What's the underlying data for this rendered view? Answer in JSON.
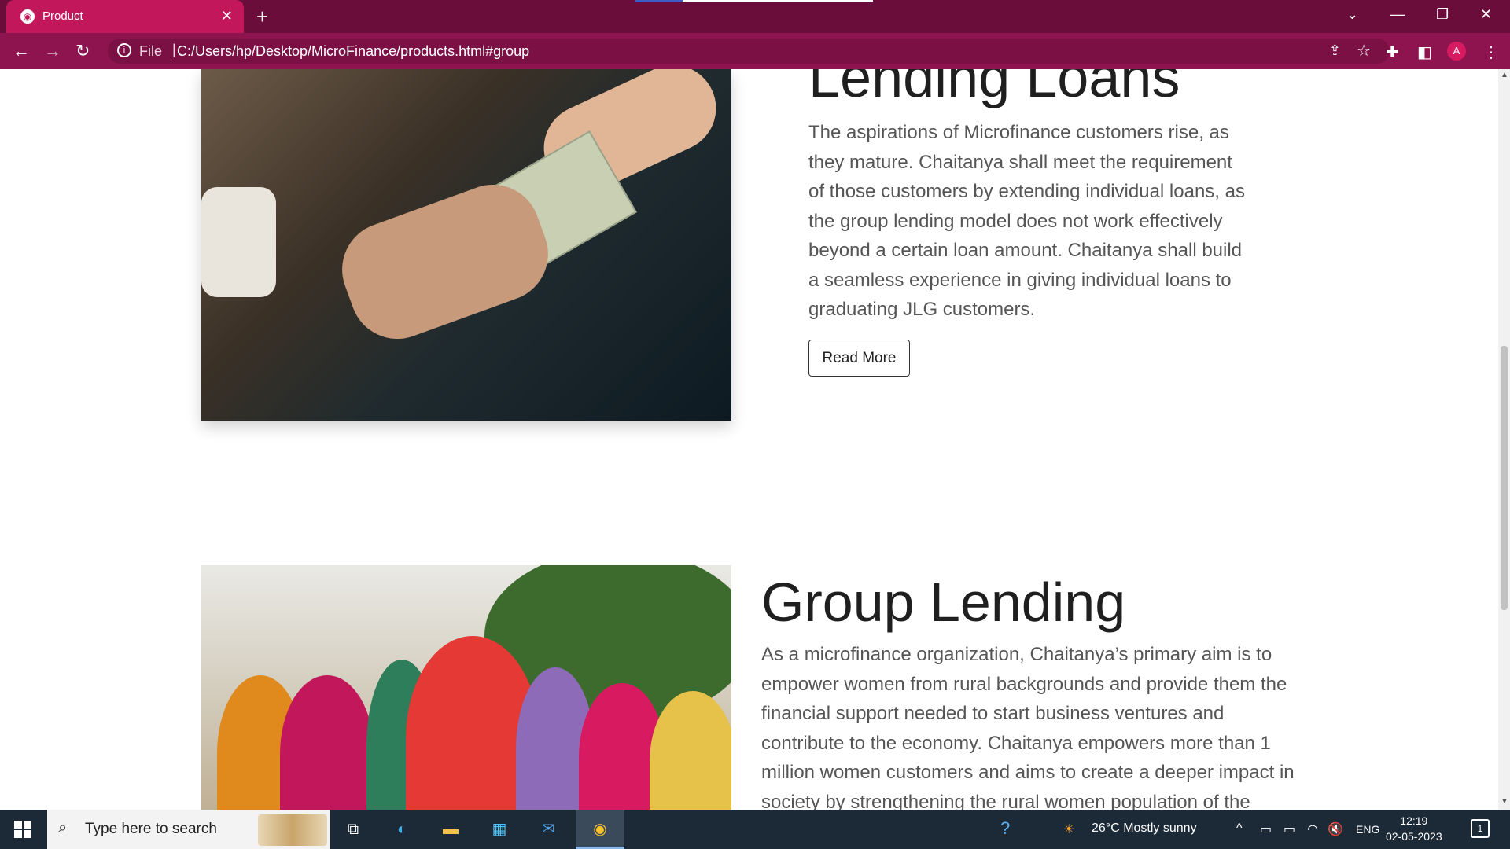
{
  "browser": {
    "tab_title": "Product",
    "tab_close": "✕",
    "new_tab": "+",
    "file_label": "File",
    "separator": "|",
    "url": "C:/Users/hp/Desktop/MicroFinance/products.html#group",
    "profile_initial": "A"
  },
  "sections": {
    "individual": {
      "heading": "Lending Loans",
      "body": "The aspirations of Microfinance customers rise, as they mature. Chaitanya shall meet the requirement of those customers by extending individual loans, as the group lending model does not work effectively beyond a certain loan amount. Chaitanya shall build a seamless experience in giving individual loans to graduating JLG customers.",
      "button": "Read More"
    },
    "group": {
      "heading": "Group Lending",
      "body": "As a microfinance organization, Chaitanya’s primary aim is to empower women from rural backgrounds and provide them the financial support needed to start business ventures and contribute to the economy. Chaitanya empowers more than 1 million women customers and aims to create a deeper impact in society by strengthening the rural women population of the"
    }
  },
  "taskbar": {
    "search_placeholder": "Type here to search",
    "weather": "26°C  Mostly sunny",
    "language": "ENG",
    "time": "12:19",
    "date": "02-05-2023",
    "notifications": "1"
  }
}
